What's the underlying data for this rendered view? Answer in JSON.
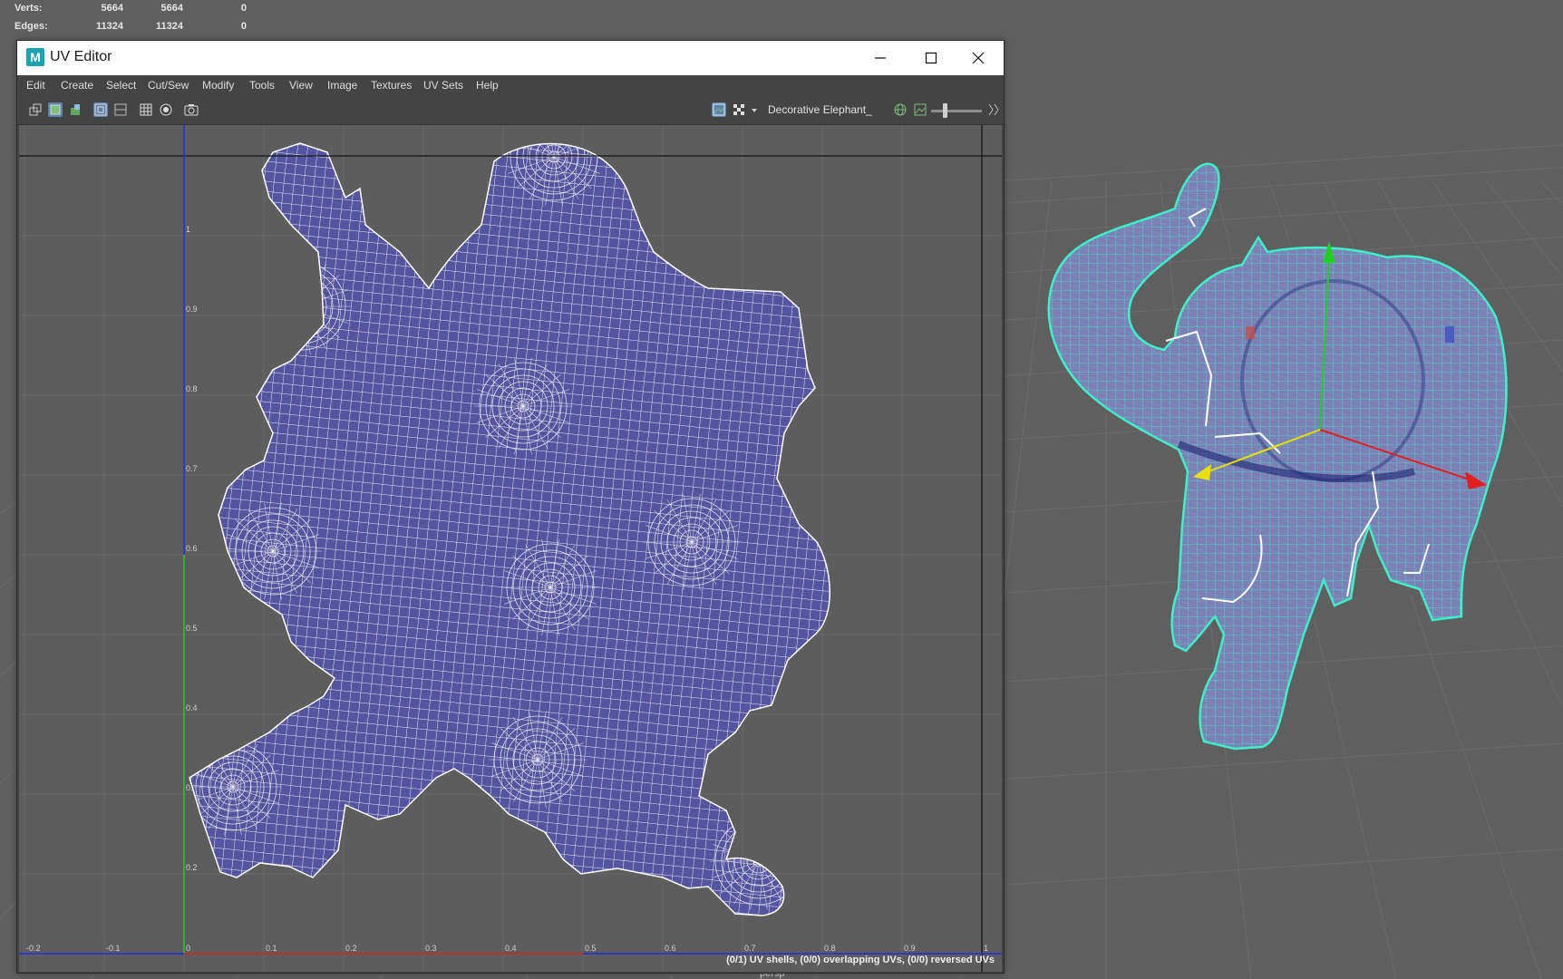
{
  "hud": {
    "rows": [
      {
        "label": "Verts:",
        "v1": "5664",
        "v2": "5664",
        "v3": "0"
      },
      {
        "label": "Edges:",
        "v1": "11324",
        "v2": "11324",
        "v3": "0"
      }
    ]
  },
  "window": {
    "title": "UV Editor",
    "logo_letter": "M"
  },
  "menu": [
    "Edit",
    "Create",
    "Select",
    "Cut/Sew",
    "Modify",
    "Tools",
    "View",
    "Image",
    "Textures",
    "UV Sets",
    "Help"
  ],
  "toolbar": {
    "texture_name": "Decorative Elephant_"
  },
  "uv_grid": {
    "axis_x_labels": [
      "-0.2",
      "-0.1",
      "0",
      "0.1",
      "0.2",
      "0.3",
      "0.4",
      "0.5",
      "0.6",
      "0.7",
      "0.8",
      "0.9",
      "1"
    ],
    "axis_y_labels": [
      "0.2",
      "0.3",
      "0.4",
      "0.5",
      "0.6",
      "0.7",
      "0.8",
      "0.9",
      "1"
    ]
  },
  "status": {
    "text": "(0/1) UV shells, (0/0) overlapping UVs, (0/0) reversed UVs"
  },
  "viewport": {
    "camera_label": "persp",
    "model_name": "Decorative Elephant"
  },
  "colors": {
    "uv_fill": "#55559f",
    "wire_cyan": "#3ef0c8",
    "model_fill": "#7f7fb8",
    "axis_red": "#e02020",
    "axis_green": "#20d020",
    "axis_blue": "#2030e0",
    "axis_yellow": "#e8e000"
  }
}
